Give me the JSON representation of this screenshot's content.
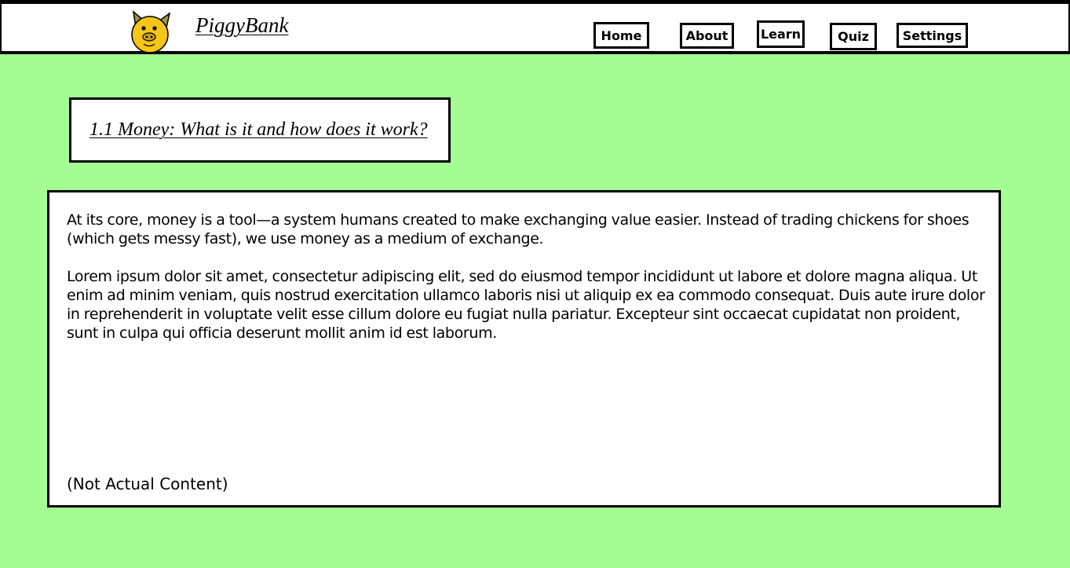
{
  "brand": {
    "name": "PiggyBank",
    "logo_icon": "pig-face-icon"
  },
  "nav": {
    "home": "Home",
    "about": "About",
    "learn": "Learn",
    "quiz": "Quiz",
    "settings": "Settings"
  },
  "lesson": {
    "title": "1.1 Money: What is it and how does it work?",
    "paragraphs": [
      "At its core, money is a tool—a system humans created to make exchanging value easier. Instead of trading chickens for shoes (which gets messy fast), we use money as a medium of exchange.",
      "Lorem ipsum dolor sit amet, consectetur adipiscing elit, sed do eiusmod tempor incididunt ut labore et dolore magna aliqua. Ut enim ad minim veniam, quis nostrud exercitation ullamco laboris nisi ut aliquip ex ea commodo consequat. Duis aute irure dolor in reprehenderit in voluptate velit esse cillum dolore eu fugiat nulla pariatur. Excepteur sint occaecat cupidatat non proident, sunt in culpa qui officia deserunt mollit anim id est laborum."
    ],
    "note": "(Not Actual Content)"
  },
  "colors": {
    "page_background": "#a4fc92",
    "panel_background": "#ffffff",
    "border": "#000000",
    "pig_face": "#f5c518"
  }
}
